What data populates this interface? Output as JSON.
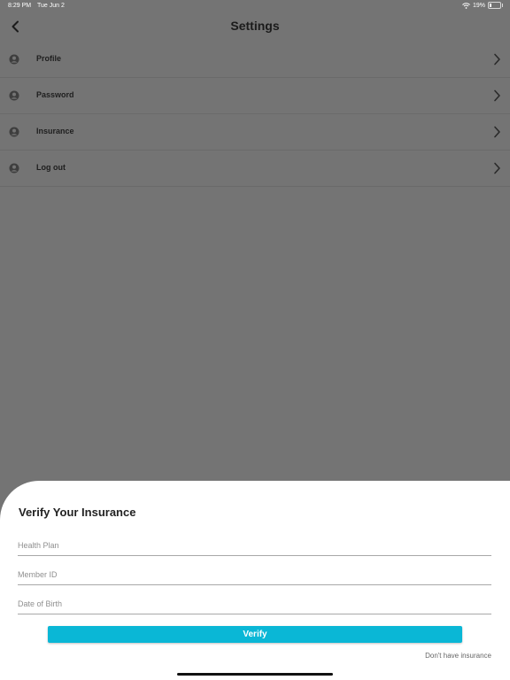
{
  "status_bar": {
    "time": "8:29 PM",
    "date": "Tue Jun 2",
    "battery": "19%",
    "battery_level": 0.19
  },
  "header": {
    "title": "Settings",
    "back_icon": "chevron-left-icon"
  },
  "settings": {
    "items": [
      {
        "label": "Profile",
        "icon": "user-circle-icon"
      },
      {
        "label": "Password",
        "icon": "user-circle-icon"
      },
      {
        "label": "Insurance",
        "icon": "user-circle-icon"
      },
      {
        "label": "Log out",
        "icon": "user-circle-icon"
      }
    ]
  },
  "sheet": {
    "title": "Verify Your Insurance",
    "health_plan_placeholder": "Health Plan",
    "member_id_placeholder": "Member ID",
    "dob_placeholder": "Date of Birth",
    "verify_label": "Verify",
    "no_insurance_label": "Don't have insurance"
  },
  "colors": {
    "overlay_background": "#747474",
    "accent": "#0ab7d6",
    "sheet_background": "#ffffff"
  }
}
